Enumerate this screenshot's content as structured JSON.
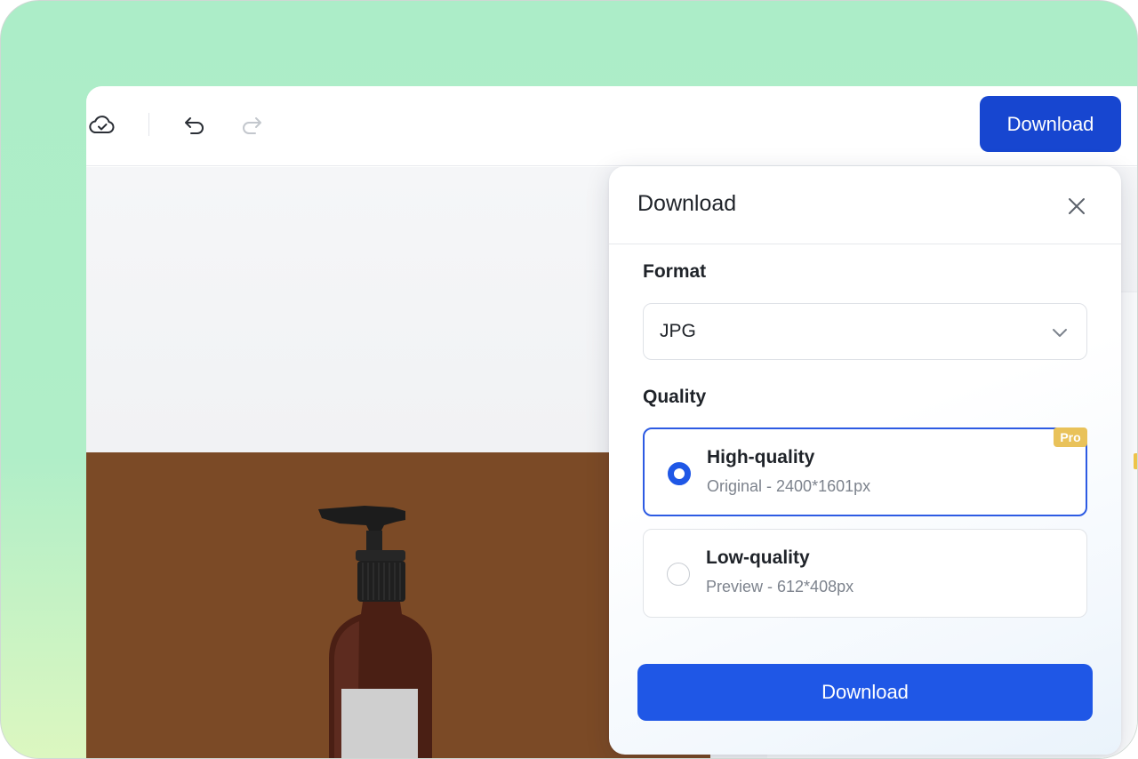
{
  "toolbar": {
    "cloud_icon": "cloud-saved-icon",
    "undo_icon": "undo-icon",
    "redo_icon": "redo-icon",
    "download_label": "Download"
  },
  "dialog": {
    "title": "Download",
    "close_icon": "close-icon",
    "format": {
      "label": "Format",
      "selected": "JPG",
      "chevron_icon": "chevron-down-icon"
    },
    "quality": {
      "label": "Quality",
      "options": [
        {
          "title": "High-quality",
          "subtitle": "Original - 2400*1601px",
          "selected": true,
          "badge": "Pro"
        },
        {
          "title": "Low-quality",
          "subtitle": "Preview - 612*408px",
          "selected": false
        }
      ]
    },
    "download_label": "Download"
  },
  "colors": {
    "primary": "#1f57e6",
    "top_button": "#1746d0",
    "pro_badge": "#e9c25a",
    "canvas_image_bg": "#7b4a26",
    "frame_bg": "#acedc8"
  }
}
